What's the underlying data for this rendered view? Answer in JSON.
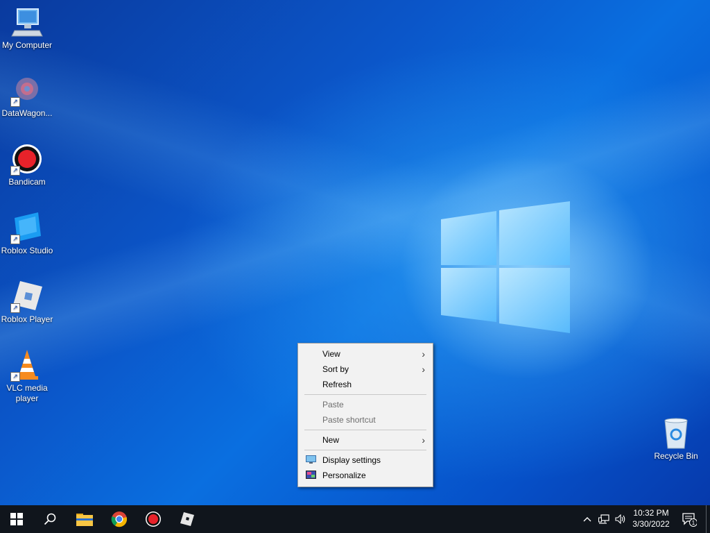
{
  "desktop": {
    "icons": [
      {
        "label": "My Computer",
        "icon": "my-computer-icon"
      },
      {
        "label": "DataWagon...",
        "icon": "datawagon-icon"
      },
      {
        "label": "Bandicam",
        "icon": "bandicam-icon"
      },
      {
        "label": "Roblox Studio",
        "icon": "roblox-studio-icon"
      },
      {
        "label": "Roblox Player",
        "icon": "roblox-player-icon"
      },
      {
        "label": "VLC media player",
        "icon": "vlc-icon"
      }
    ],
    "recycle_bin": {
      "label": "Recycle Bin",
      "icon": "recycle-bin-icon"
    }
  },
  "context_menu": {
    "items": [
      {
        "label": "View",
        "submenu": true
      },
      {
        "label": "Sort by",
        "submenu": true
      },
      {
        "label": "Refresh"
      },
      {
        "label": "Paste",
        "disabled": true
      },
      {
        "label": "Paste shortcut",
        "disabled": true
      },
      {
        "label": "New",
        "submenu": true
      },
      {
        "label": "Display settings",
        "icon": "display-settings-icon"
      },
      {
        "label": "Personalize",
        "icon": "personalize-icon"
      }
    ]
  },
  "taskbar": {
    "buttons": [
      "start-icon",
      "search-icon",
      "file-explorer-icon",
      "chrome-icon",
      "bandicam-icon",
      "roblox-icon"
    ],
    "tray": {
      "time": "10:32 PM",
      "date": "3/30/2022",
      "notification_count": "1"
    }
  },
  "colors": {
    "taskbar": "#10151c",
    "desktop_accent": "#0a6fe0",
    "menu_background": "#f2f2f2"
  }
}
